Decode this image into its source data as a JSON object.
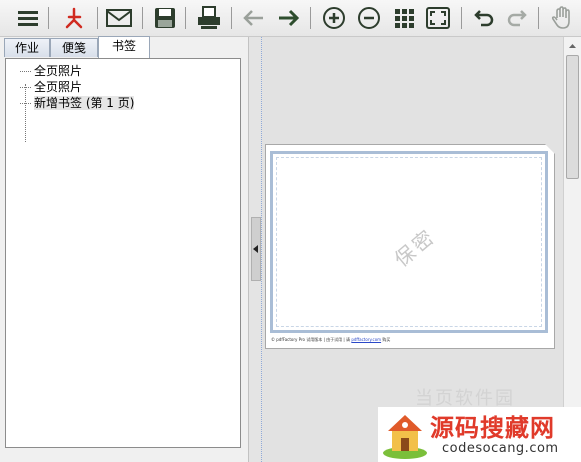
{
  "toolbar": {
    "buttons": [
      {
        "name": "menu-icon"
      },
      {
        "name": "pdf-icon"
      },
      {
        "name": "mail-icon"
      },
      {
        "name": "save-icon"
      },
      {
        "name": "print-icon"
      },
      {
        "name": "back-arrow-icon"
      },
      {
        "name": "forward-arrow-icon"
      },
      {
        "name": "zoom-in-icon"
      },
      {
        "name": "zoom-out-icon"
      },
      {
        "name": "thumbnails-grid-icon"
      },
      {
        "name": "fullscreen-icon"
      },
      {
        "name": "undo-icon"
      },
      {
        "name": "redo-icon"
      },
      {
        "name": "hand-tool-icon"
      }
    ]
  },
  "tabs": [
    {
      "label": "作业"
    },
    {
      "label": "便笺"
    },
    {
      "label": "书签",
      "active": true
    }
  ],
  "tree": {
    "items": [
      {
        "label": "全页照片"
      },
      {
        "label": "全页照片"
      },
      {
        "label": "新增书签 (第 1 页)",
        "selected": true
      }
    ]
  },
  "document": {
    "watermark": "保密",
    "footer_text": "© pdfFactory Pro 试用版本 | 由于试用 | 请 ",
    "footer_link": "pdffactory.com",
    "footer_tail": " 购买"
  },
  "caption": "当页软件园",
  "badge": {
    "title": "源码搜藏网",
    "url": "codesocang.com"
  },
  "colors": {
    "accent_green": "#2f4f2f",
    "pdf_red": "#d02a20",
    "badge_red": "#e03a2a"
  }
}
